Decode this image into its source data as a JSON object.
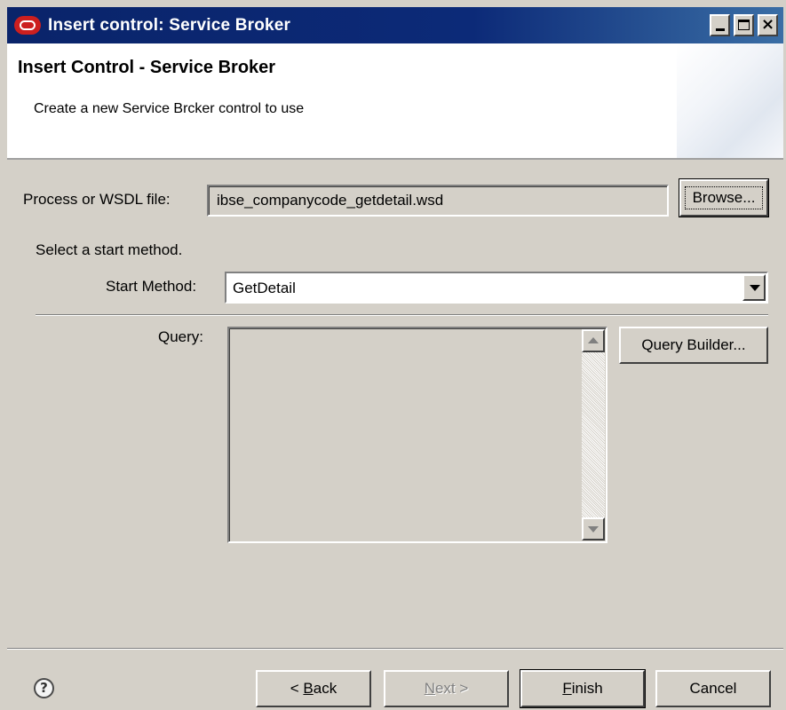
{
  "window": {
    "title": "Insert control: Service Broker",
    "controls": {
      "minimize": "minimize",
      "maximize": "maximize",
      "close": "×"
    }
  },
  "header": {
    "title": "Insert Control - Service Broker",
    "description": "Create a new Service Brcker control to use"
  },
  "form": {
    "wsdl_label": "Process or WSDL file:",
    "wsdl_value": "ibse_companycode_getdetail.wsd",
    "browse_label": "Browse...",
    "select_prompt": "Select a start method.",
    "start_method_label": "Start Method:",
    "start_method_value": "GetDetail",
    "query_label": "Query:",
    "query_value": "",
    "query_builder_label": "Query Builder..."
  },
  "footer": {
    "help_icon": "?",
    "back": {
      "prefix": "< ",
      "mnemonic": "B",
      "rest": "ack"
    },
    "next": {
      "mnemonic": "N",
      "rest": "ext >"
    },
    "finish": {
      "mnemonic": "F",
      "rest": "inish"
    },
    "cancel": "Cancel"
  },
  "icons": [
    "app-icon",
    "minimize-icon",
    "maximize-icon",
    "close-icon",
    "dropdown-arrow-icon",
    "scroll-up-icon",
    "scroll-down-icon",
    "help-icon"
  ]
}
